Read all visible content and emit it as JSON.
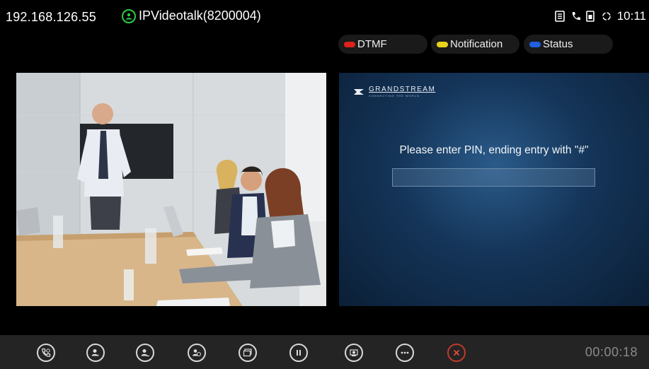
{
  "status_bar": {
    "ip_address": "192.168.126.55",
    "account_name": "IPVideotalk(8200004)",
    "clock": "10:11",
    "icons": [
      "contacts-icon",
      "call-icon",
      "sim-icon",
      "sync-icon"
    ]
  },
  "pills": {
    "dtmf": {
      "label": "DTMF",
      "color": "#e0201b"
    },
    "notification": {
      "label": "Notification",
      "color": "#e8d21a"
    },
    "status": {
      "label": "Status",
      "color": "#1f5fe0"
    }
  },
  "remote_panel": {
    "brand": "GRANDSTREAM",
    "brand_tagline": "CONNECTING THE WORLD",
    "prompt": "Please enter PIN, ending entry with \"#\"",
    "pin_value": ""
  },
  "controls": {
    "buttons": [
      {
        "name": "call-icon"
      },
      {
        "name": "add-participant-icon"
      },
      {
        "name": "remove-participant-icon"
      },
      {
        "name": "participants-icon"
      },
      {
        "name": "screen-share-icon"
      },
      {
        "name": "hold-icon"
      },
      {
        "name": "camera-icon"
      },
      {
        "name": "more-icon"
      },
      {
        "name": "end-call-icon"
      }
    ],
    "timer": "00:00:18"
  },
  "colors": {
    "accent_green": "#2ecc40",
    "end_call_red": "#c0392b",
    "control_bar_bg": "#242424"
  }
}
